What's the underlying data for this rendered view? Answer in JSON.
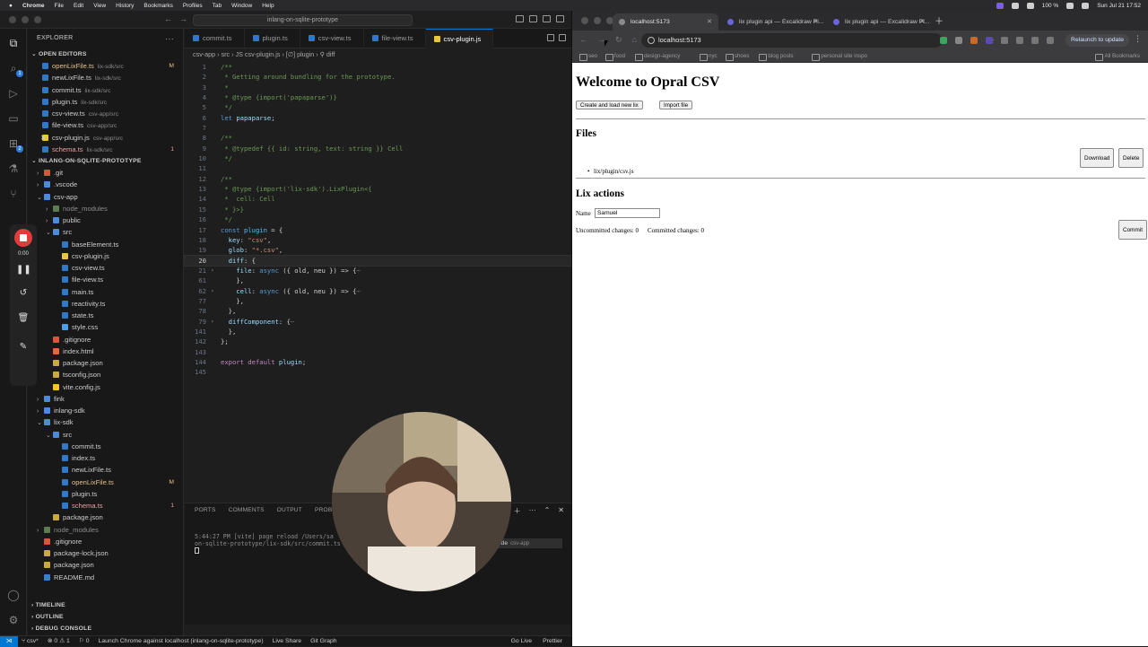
{
  "macbar": {
    "menu": [
      "Chrome",
      "File",
      "Edit",
      "View",
      "History",
      "Bookmarks",
      "Profiles",
      "Tab",
      "Window",
      "Help"
    ],
    "battery": "100 %",
    "datetime": "Sun Jul 21  17:52"
  },
  "vscode": {
    "command_center": "inlang-on-sqlite-prototype",
    "explorer_title": "EXPLORER",
    "open_editors_title": "OPEN EDITORS",
    "open_editors": [
      {
        "name": "openLixFile.ts",
        "path": "lix-sdk/src",
        "mark": "M",
        "state": "modified",
        "icon": "ts"
      },
      {
        "name": "newLixFile.ts",
        "path": "lix-sdk/src",
        "mark": "",
        "state": "",
        "icon": "ts"
      },
      {
        "name": "commit.ts",
        "path": "lix-sdk/src",
        "mark": "",
        "state": "",
        "icon": "ts"
      },
      {
        "name": "plugin.ts",
        "path": "lix-sdk/src",
        "mark": "",
        "state": "",
        "icon": "ts"
      },
      {
        "name": "csv-view.ts",
        "path": "csv-app/src",
        "mark": "",
        "state": "",
        "icon": "ts"
      },
      {
        "name": "file-view.ts",
        "path": "csv-app/src",
        "mark": "",
        "state": "",
        "icon": "ts"
      },
      {
        "name": "csv-plugin.js",
        "path": "csv-app/src",
        "mark": "",
        "state": "selected",
        "icon": "js"
      },
      {
        "name": "schema.ts",
        "path": "lix-sdk/src",
        "mark": "1",
        "state": "error",
        "icon": "ts"
      }
    ],
    "project_title": "INLANG-ON-SQLITE-PROTOTYPE",
    "tree": [
      {
        "name": ".git",
        "depth": 1,
        "icon": "git",
        "chev": "›",
        "state": ""
      },
      {
        "name": ".vscode",
        "depth": 1,
        "icon": "folder",
        "chev": "›",
        "state": ""
      },
      {
        "name": "csv-app",
        "depth": 1,
        "icon": "folder",
        "chev": "⌄",
        "state": ""
      },
      {
        "name": "node_modules",
        "depth": 2,
        "icon": "fmuted",
        "chev": "›",
        "state": "muted"
      },
      {
        "name": "public",
        "depth": 2,
        "icon": "folder",
        "chev": "›",
        "state": ""
      },
      {
        "name": "src",
        "depth": 2,
        "icon": "folder",
        "chev": "⌄",
        "state": ""
      },
      {
        "name": "baseElement.ts",
        "depth": 3,
        "icon": "ts",
        "chev": "",
        "state": ""
      },
      {
        "name": "csv-plugin.js",
        "depth": 3,
        "icon": "js",
        "chev": "",
        "state": "selected"
      },
      {
        "name": "csv-view.ts",
        "depth": 3,
        "icon": "ts",
        "chev": "",
        "state": ""
      },
      {
        "name": "file-view.ts",
        "depth": 3,
        "icon": "ts",
        "chev": "",
        "state": ""
      },
      {
        "name": "main.ts",
        "depth": 3,
        "icon": "ts",
        "chev": "",
        "state": ""
      },
      {
        "name": "reactivity.ts",
        "depth": 3,
        "icon": "ts",
        "chev": "",
        "state": ""
      },
      {
        "name": "state.ts",
        "depth": 3,
        "icon": "ts",
        "chev": "",
        "state": ""
      },
      {
        "name": "style.css",
        "depth": 3,
        "icon": "css",
        "chev": "",
        "state": ""
      },
      {
        "name": ".gitignore",
        "depth": 2,
        "icon": "git",
        "chev": "",
        "state": ""
      },
      {
        "name": "index.html",
        "depth": 2,
        "icon": "html",
        "chev": "",
        "state": ""
      },
      {
        "name": "package.json",
        "depth": 2,
        "icon": "json",
        "chev": "",
        "state": ""
      },
      {
        "name": "tsconfig.json",
        "depth": 2,
        "icon": "json",
        "chev": "",
        "state": ""
      },
      {
        "name": "vite.config.js",
        "depth": 2,
        "icon": "vite",
        "chev": "",
        "state": ""
      },
      {
        "name": "fink",
        "depth": 1,
        "icon": "folder",
        "chev": "›",
        "state": ""
      },
      {
        "name": "inlang-sdk",
        "depth": 1,
        "icon": "folder",
        "chev": "›",
        "state": ""
      },
      {
        "name": "lix-sdk",
        "depth": 1,
        "icon": "folder",
        "chev": "⌄",
        "state": ""
      },
      {
        "name": "src",
        "depth": 2,
        "icon": "folder",
        "chev": "⌄",
        "state": ""
      },
      {
        "name": "commit.ts",
        "depth": 3,
        "icon": "ts",
        "chev": "",
        "state": ""
      },
      {
        "name": "index.ts",
        "depth": 3,
        "icon": "ts",
        "chev": "",
        "state": ""
      },
      {
        "name": "newLixFile.ts",
        "depth": 3,
        "icon": "ts",
        "chev": "",
        "state": ""
      },
      {
        "name": "openLixFile.ts",
        "depth": 3,
        "icon": "ts",
        "chev": "",
        "state": "modified",
        "mark": "M"
      },
      {
        "name": "plugin.ts",
        "depth": 3,
        "icon": "ts",
        "chev": "",
        "state": ""
      },
      {
        "name": "schema.ts",
        "depth": 3,
        "icon": "ts",
        "chev": "",
        "state": "error",
        "mark": "1"
      },
      {
        "name": "package.json",
        "depth": 2,
        "icon": "json",
        "chev": "",
        "state": ""
      },
      {
        "name": "node_modules",
        "depth": 1,
        "icon": "fmuted",
        "chev": "›",
        "state": "muted"
      },
      {
        "name": ".gitignore",
        "depth": 1,
        "icon": "git",
        "chev": "",
        "state": ""
      },
      {
        "name": "package-lock.json",
        "depth": 1,
        "icon": "json",
        "chev": "",
        "state": ""
      },
      {
        "name": "package.json",
        "depth": 1,
        "icon": "json",
        "chev": "",
        "state": ""
      },
      {
        "name": "README.md",
        "depth": 1,
        "icon": "md",
        "chev": "",
        "state": ""
      }
    ],
    "bottom_sections": [
      "TIMELINE",
      "OUTLINE",
      "DEBUG CONSOLE"
    ],
    "tabs": [
      {
        "name": "commit.ts",
        "icon": "ts",
        "active": false
      },
      {
        "name": "plugin.ts",
        "icon": "ts",
        "active": false
      },
      {
        "name": "csv-view.ts",
        "icon": "ts",
        "active": false
      },
      {
        "name": "file-view.ts",
        "icon": "ts",
        "active": false
      },
      {
        "name": "csv-plugin.js",
        "icon": "js",
        "active": true
      }
    ],
    "breadcrumb": "csv-app › src › JS csv-plugin.js › [∅] plugin › ⚲ diff",
    "code": [
      {
        "n": "1",
        "t": [
          [
            "/**",
            "com"
          ]
        ]
      },
      {
        "n": "2",
        "t": [
          [
            " * Getting around bundling for the prototype.",
            "com"
          ]
        ]
      },
      {
        "n": "3",
        "t": [
          [
            " *",
            "com"
          ]
        ]
      },
      {
        "n": "4",
        "t": [
          [
            " * @type {import('papaparse')}",
            "com"
          ]
        ]
      },
      {
        "n": "5",
        "t": [
          [
            " */",
            "com"
          ]
        ]
      },
      {
        "n": "6",
        "t": [
          [
            "let ",
            "kw"
          ],
          [
            "papaparse",
            "prop"
          ],
          [
            ";",
            "pun"
          ]
        ]
      },
      {
        "n": "7",
        "t": []
      },
      {
        "n": "8",
        "t": [
          [
            "/**",
            "com"
          ]
        ]
      },
      {
        "n": "9",
        "t": [
          [
            " * @typedef {{ id: string, text: string }} Cell",
            "com"
          ]
        ]
      },
      {
        "n": "10",
        "t": [
          [
            " */",
            "com"
          ]
        ]
      },
      {
        "n": "11",
        "t": []
      },
      {
        "n": "12",
        "t": [
          [
            "/**",
            "com"
          ]
        ]
      },
      {
        "n": "13",
        "t": [
          [
            " * @type {import('lix-sdk').LixPlugin<{",
            "com"
          ]
        ]
      },
      {
        "n": "14",
        "t": [
          [
            " *  cell: Cell",
            "com"
          ]
        ]
      },
      {
        "n": "15",
        "t": [
          [
            " * }>}",
            "com"
          ]
        ]
      },
      {
        "n": "16",
        "t": [
          [
            " */",
            "com"
          ]
        ]
      },
      {
        "n": "17",
        "t": [
          [
            "const ",
            "kw"
          ],
          [
            "plugin",
            "var"
          ],
          [
            " = {",
            "pun"
          ]
        ]
      },
      {
        "n": "18",
        "t": [
          [
            "  key",
            "prop"
          ],
          [
            ": ",
            "pun"
          ],
          [
            "\"csv\"",
            "str"
          ],
          [
            ",",
            "pun"
          ]
        ]
      },
      {
        "n": "19",
        "t": [
          [
            "  glob",
            "prop"
          ],
          [
            ": ",
            "pun"
          ],
          [
            "\"*.csv\"",
            "str"
          ],
          [
            ",",
            "pun"
          ]
        ]
      },
      {
        "n": "20",
        "t": [
          [
            "  diff",
            "prop"
          ],
          [
            ": {",
            "pun"
          ]
        ],
        "cur": true
      },
      {
        "n": "21",
        "t": [
          [
            "    file",
            "prop"
          ],
          [
            ": ",
            "pun"
          ],
          [
            "async",
            "kw"
          ],
          [
            " ({ old, neu }) => {",
            "pun"
          ],
          [
            "⋯",
            "dim"
          ]
        ],
        "fold": true
      },
      {
        "n": "61",
        "t": [
          [
            "    },",
            "pun"
          ]
        ]
      },
      {
        "n": "62",
        "t": [
          [
            "    cell",
            "prop"
          ],
          [
            ": ",
            "pun"
          ],
          [
            "async",
            "kw"
          ],
          [
            " ({ old, neu }) => {",
            "pun"
          ],
          [
            "⋯",
            "dim"
          ]
        ],
        "fold": true
      },
      {
        "n": "77",
        "t": [
          [
            "    },",
            "pun"
          ]
        ]
      },
      {
        "n": "78",
        "t": [
          [
            "  },",
            "pun"
          ]
        ]
      },
      {
        "n": "79",
        "t": [
          [
            "  diffComponent",
            "prop"
          ],
          [
            ": {",
            "pun"
          ],
          [
            "⋯",
            "dim"
          ]
        ],
        "fold": true
      },
      {
        "n": "141",
        "t": [
          [
            "  },",
            "pun"
          ]
        ]
      },
      {
        "n": "142",
        "t": [
          [
            "};",
            "pun"
          ]
        ]
      },
      {
        "n": "143",
        "t": []
      },
      {
        "n": "144",
        "t": [
          [
            "export ",
            "ctl"
          ],
          [
            "default ",
            "ctl"
          ],
          [
            "plugin",
            "prop"
          ],
          [
            ";",
            "pun"
          ]
        ]
      },
      {
        "n": "145",
        "t": []
      }
    ],
    "panel_tabs": [
      "PORTS",
      "COMMENTS",
      "OUTPUT",
      "PROBLEMS"
    ],
    "terminal_line1": "5:44:27 PM [vite] page reload /Users/sa",
    "terminal_line2": "on-sqlite-prototype/lix-sdk/src/commit.ts",
    "terminals": [
      {
        "name": "zsh",
        "sub": ""
      },
      {
        "name": "node",
        "sub": "csv-app"
      }
    ],
    "status_left": [
      "⊗ 0  ⚠ 1",
      "⚐ 0",
      "Launch Chrome against localhost (inlang-on-sqlite-prototype)",
      "Live Share",
      "Git Graph"
    ],
    "status_right": [
      "Go Live",
      "Prettier"
    ],
    "status_remote": "csv*",
    "recording_time": "0:00"
  },
  "chrome": {
    "tabs": [
      {
        "title": "localhost:5173",
        "active": true,
        "icon": "page"
      },
      {
        "title": "lix plugin api — Excalidraw Pl...",
        "active": false,
        "icon": "excalidraw"
      },
      {
        "title": "lix plugin api — Excalidraw Pl...",
        "active": false,
        "icon": "excalidraw"
      }
    ],
    "url": "localhost:5173",
    "relaunch": "Relaunch to update",
    "bookmarks": [
      "seo",
      "food",
      "design-agency",
      "nyc",
      "shoes",
      "blog posts",
      "personal site inspo"
    ],
    "all_bookmarks": "All Bookmarks"
  },
  "app": {
    "title": "Welcome to Opral CSV",
    "create_button": "Create and load new lix",
    "import_button": "Import file",
    "files_heading": "Files",
    "file_item": "lix/plugin/csv.js",
    "download_button": "Download",
    "delete_button": "Delete",
    "actions_heading": "Lix actions",
    "name_label": "Name",
    "name_value": "Samuel",
    "uncommitted": "Uncommitted changes: 0",
    "committed": "Committed changes: 0",
    "commit_button": "Commit"
  }
}
